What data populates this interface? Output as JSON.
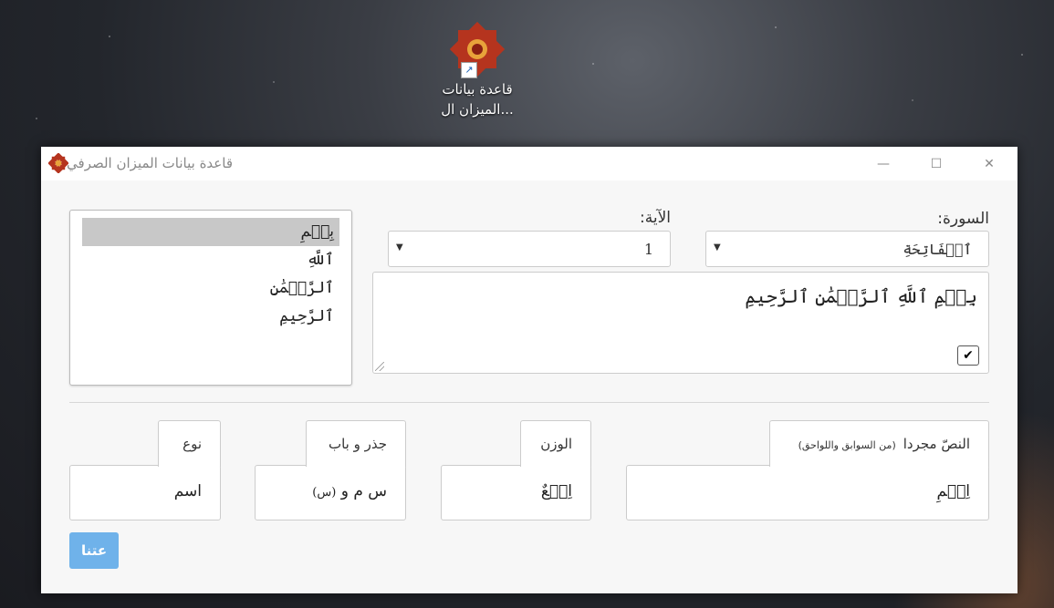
{
  "desktop": {
    "icon_label_line1": "قاعدة بيانات",
    "icon_label_line2": "...الميزان ال"
  },
  "window": {
    "title": "قاعدة بيانات الميزان الصرفي",
    "minimize": "—",
    "maximize": "☐",
    "close": "✕"
  },
  "words_list": [
    "بِسۡمِ",
    "ٱللَّهِ",
    "ٱلرَّحۡمَٰنِ",
    "ٱلرَّحِيمِ"
  ],
  "surah": {
    "label": "السورة:",
    "value": "ٱلۡفَاتِحَةِ",
    "arrow": "▼"
  },
  "ayah": {
    "label": "الآية:",
    "value": "1",
    "arrow": "▼"
  },
  "ayah_text": "بِسۡمِ ٱللَّهِ ٱلرَّحۡمَٰنِ ٱلرَّحِيمِ",
  "checkbox_mark": "✔",
  "cards": {
    "stripped": {
      "tab_label": "النصّ مجردا",
      "tab_note": "(من السوابق واللواحق)",
      "value": "اِسۡمِ"
    },
    "weight": {
      "tab_label": "الوزن",
      "value": "اِفۡعٌ"
    },
    "root": {
      "tab_label": "جذر و باب",
      "value": "س م و",
      "note": "(س)"
    },
    "type": {
      "tab_label": "نوع",
      "value": "اسم"
    }
  },
  "button_label": "عتنا"
}
